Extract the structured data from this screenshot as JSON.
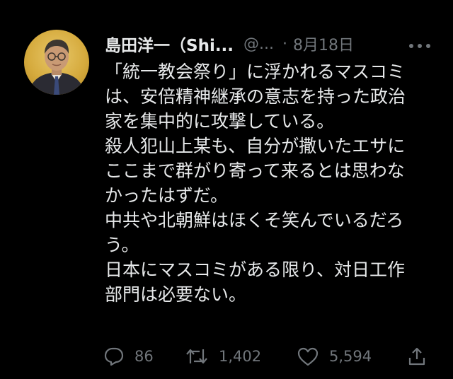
{
  "tweet": {
    "display_name": "島田洋一（Shi...",
    "handle": "@...",
    "separator": "·",
    "date": "8月18日",
    "lines": [
      "「統一教会祭り」に浮かれるマスコミ",
      "は、安倍精神継承の意志を持った政治",
      "家を集中的に攻撃している。",
      "殺人犯山上某も、自分が撒いたエサに",
      "ここまで群がり寄って来るとは思わな",
      "かったはずだ。",
      "中共や北朝鮮はほくそ笑んでいるだろ",
      "う。",
      "日本にマスコミがある限り、対日工作",
      "部門は必要ない。"
    ]
  },
  "actions": {
    "reply": {
      "icon": "reply-icon",
      "count": "86"
    },
    "retweet": {
      "icon": "retweet-icon",
      "count": "1,402"
    },
    "like": {
      "icon": "heart-icon",
      "count": "5,594"
    },
    "share": {
      "icon": "share-icon"
    }
  },
  "colors": {
    "background": "#000000",
    "primary_text": "#e7e9ea",
    "secondary_text": "#71767b"
  }
}
